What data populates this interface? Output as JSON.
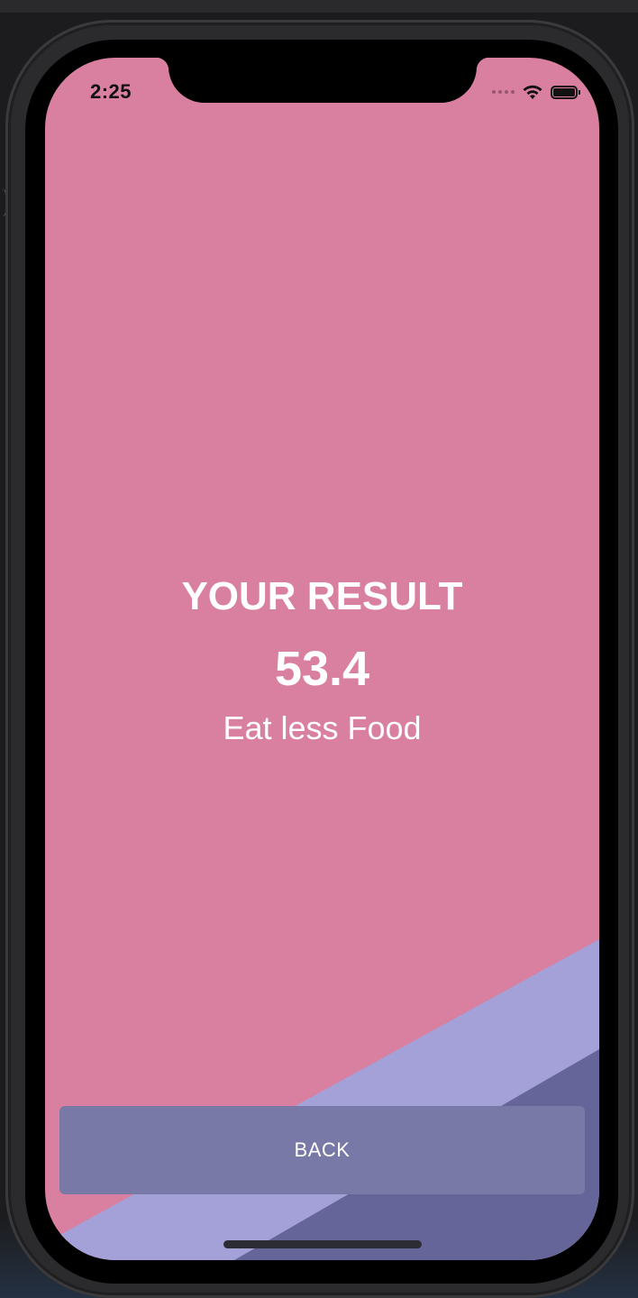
{
  "status_bar": {
    "time": "2:25",
    "icons": [
      "cellular-signal-icon",
      "wifi-icon",
      "battery-icon"
    ]
  },
  "result": {
    "title": "YOUR RESULT",
    "value": "53.4",
    "advice": "Eat less Food"
  },
  "actions": {
    "back_label": "BACK"
  },
  "colors": {
    "background": "#d97f9f",
    "band_light": "#a3a1d8",
    "band_dark": "#666599",
    "button": "#7979a8",
    "text": "#ffffff"
  }
}
